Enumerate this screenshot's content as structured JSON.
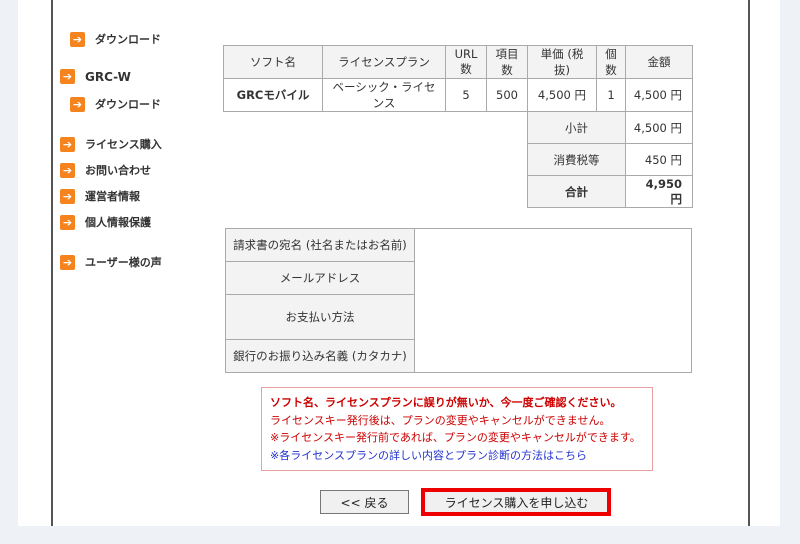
{
  "sidebar": {
    "items": [
      {
        "label": "ダウンロード"
      },
      {
        "label": "GRC-W"
      },
      {
        "label": "ダウンロード"
      },
      {
        "label": "ライセンス購入"
      },
      {
        "label": "お問い合わせ"
      },
      {
        "label": "運営者情報"
      },
      {
        "label": "個人情報保護"
      },
      {
        "label": "ユーザー様の声"
      }
    ]
  },
  "order_table": {
    "headers": [
      "ソフト名",
      "ライセンスプラン",
      "URL数",
      "項目数",
      "単価 (税抜)",
      "個数",
      "金額"
    ],
    "row": {
      "software": "GRCモバイル",
      "plan": "ベーシック・ライセンス",
      "urls": "5",
      "items": "500",
      "unit_price": "4,500 円",
      "quantity": "1",
      "amount": "4,500 円"
    },
    "subtotal_label": "小計",
    "subtotal_value": "4,500 円",
    "tax_label": "消費税等",
    "tax_value": "450 円",
    "total_label": "合計",
    "total_value": "4,950 円"
  },
  "billing_form": {
    "fields": [
      {
        "label": "請求書の宛名 (社名またはお名前)",
        "value": ""
      },
      {
        "label": "メールアドレス",
        "value": ""
      },
      {
        "label": "お支払い方法",
        "value": ""
      },
      {
        "label": "銀行のお振り込み名義 (カタカナ)",
        "value": ""
      }
    ]
  },
  "notice": {
    "title": "ソフト名、ライセンスプランに誤りが無いか、今一度ご確認ください。",
    "line1": "ライセンスキー発行後は、プランの変更やキャンセルができません。",
    "line2": "※ライセンスキー発行前であれば、プランの変更やキャンセルができます。",
    "link": "※各ライセンスプランの詳しい内容とプラン診断の方法はこちら"
  },
  "buttons": {
    "back": "<< 戻る",
    "purchase": "ライセンス購入を申し込む"
  },
  "colors": {
    "accent_orange": "#f5841f",
    "notice_red": "#cc0000",
    "link_blue": "#2233cc",
    "highlight_red": "#ee0000"
  }
}
